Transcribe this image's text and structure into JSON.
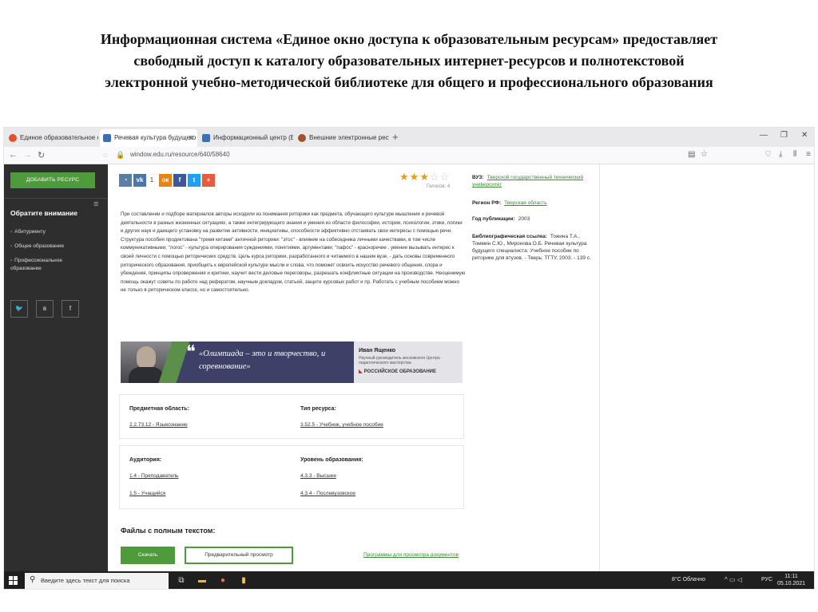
{
  "slide": {
    "heading_lines": [
      "Информационная система «Единое окно доступа к образовательным ресурсам» предоставляет",
      "свободный доступ к каталогу образовательных интернет-ресурсов и полнотекстовой",
      "электронной учебно-методической библиотеке для общего и профессионального образования"
    ]
  },
  "browser": {
    "tabs": [
      {
        "label": "Единое образовательное окно",
        "active": false,
        "color": "#e3502d"
      },
      {
        "label": "Речевая культура будущего с",
        "active": true,
        "color": "#3b6fb6"
      },
      {
        "label": "Информационный центр (Ед",
        "active": false,
        "color": "#3b6fb6"
      },
      {
        "label": "Внешние электронные ресур",
        "active": false,
        "color": "#a0522d"
      }
    ],
    "new_tab": "+",
    "url": "window.edu.ru/resource/640/58640",
    "nav_icons": [
      "back-icon",
      "forward-icon",
      "reload-icon"
    ],
    "window_controls": [
      "minimize-icon",
      "maximize-icon",
      "close-icon"
    ]
  },
  "sidebar": {
    "add_resource": "ДОБАВИТЬ РЕСУРС",
    "attention_title": "Обратите внимание",
    "items": [
      "Абитуриенту",
      "Общее образование",
      "Профессиональное образование"
    ],
    "social": [
      "tw",
      "в",
      "f"
    ]
  },
  "share": {
    "buttons": [
      {
        "icon": "classmates-share-icon",
        "glyph": "ok",
        "color": "#5b7ea3"
      },
      {
        "icon": "vk-share-icon",
        "glyph": "vk",
        "color": "#4a76a8"
      },
      {
        "icon": "counter",
        "glyph": "1",
        "color": "#ffffff"
      },
      {
        "icon": "odnoklassniki-share-icon",
        "glyph": "ок",
        "color": "#ee8208"
      },
      {
        "icon": "facebook-share-icon",
        "glyph": "f",
        "color": "#3b5998"
      },
      {
        "icon": "twitter-share-icon",
        "glyph": "t",
        "color": "#1da1f2"
      },
      {
        "icon": "more-share-icon",
        "glyph": "+",
        "color": "#e85c3c"
      }
    ]
  },
  "rating": {
    "filled": 3,
    "total": 5,
    "votes_label": "Голосов: 4"
  },
  "description": "При составлении и подборе материалов авторы исходили из понимания риторики как предмета, обучающего культуре мышления и речевой деятельности в разных жизненных ситуациях, а также интегрирующего знания и умения из области философии, истории, психологии, этики, логики и других наук и дающего установку на развитие активности, инициативы, способности эффективно отстаивать свои интересы с помощью речи. Структура пособия продиктована \"тремя китами\" античной риторики: \"этос\" - влияние на собеседника личными качествами, в том числе коммуникативными; \"логос\" - культура оперирования суждениями, понятиями, аргументами; \"пафос\" - красноречие , умение вызывать интерес к своей личности с помощью риторических средств. Цель курса риторики, разработанного и читаемого в нашем вузе, - дать основы современного риторического образования, приобщить к европейской культуре мысли и слова, что поможет освоить искусство речевого общения, спора и убеждения, принципы опровержения и критики, научит вести деловые переговоры, разрешать конфликтные ситуации на производстве. Неоценимую помощь окажут советы по работе над рефератом, научным докладом, статьей, защите курсовых работ и пр. Работать с учебным пособием можно не только в риторическом классе, но и самостоятельно.",
  "quote": {
    "mark": "❝",
    "text": "«Олимпиада – это и творчество, и соревнование»",
    "name": "Иван Ященко",
    "role": "Научный руководитель московского Центра педагогического мастерства",
    "brand": "РОССИЙСКОЕ ОБРАЗОВАНИЕ"
  },
  "subject": {
    "label": "Предметная область:",
    "link": "2.2.73.12 - Языкознание",
    "type_label": "Тип ресурса:",
    "type_link": "3.52.5 - Учебник, учебное пособие"
  },
  "audience": {
    "label": "Аудитория:",
    "links": [
      "1.4 - Преподаватель",
      "1.5 - Учащийся"
    ],
    "level_label": "Уровень образования:",
    "level_links": [
      "4.3.3 - Высшее",
      "4.3.4 - Послевузовское"
    ]
  },
  "files": {
    "title": "Файлы с полным текстом:",
    "download": "Скачать",
    "preview": "Предварительный просмотр",
    "programs": "Программы для просмотра документов"
  },
  "meta": {
    "vuz_label": "ВУЗ:",
    "vuz_value": "Тверской государственный технический университет",
    "region_label": "Регион РФ:",
    "region_value": "Тверская область",
    "year_label": "Год публикации:",
    "year_value": "2003",
    "biblio_label": "Библиографическая ссылка:",
    "biblio_value": "Тожина Т.А., Томмин С.Ю., Миронова О.Б. Речевая культура будущего специалиста: Учебное пособие по риторике для втузов. - Тверь: ТГТУ, 2003. - 139 с."
  },
  "taskbar": {
    "search_placeholder": "Введите здесь текст для поиска",
    "weather": "8°C  Облачно",
    "lang": "РУС",
    "time": "11:11",
    "date": "05.10.2021"
  }
}
